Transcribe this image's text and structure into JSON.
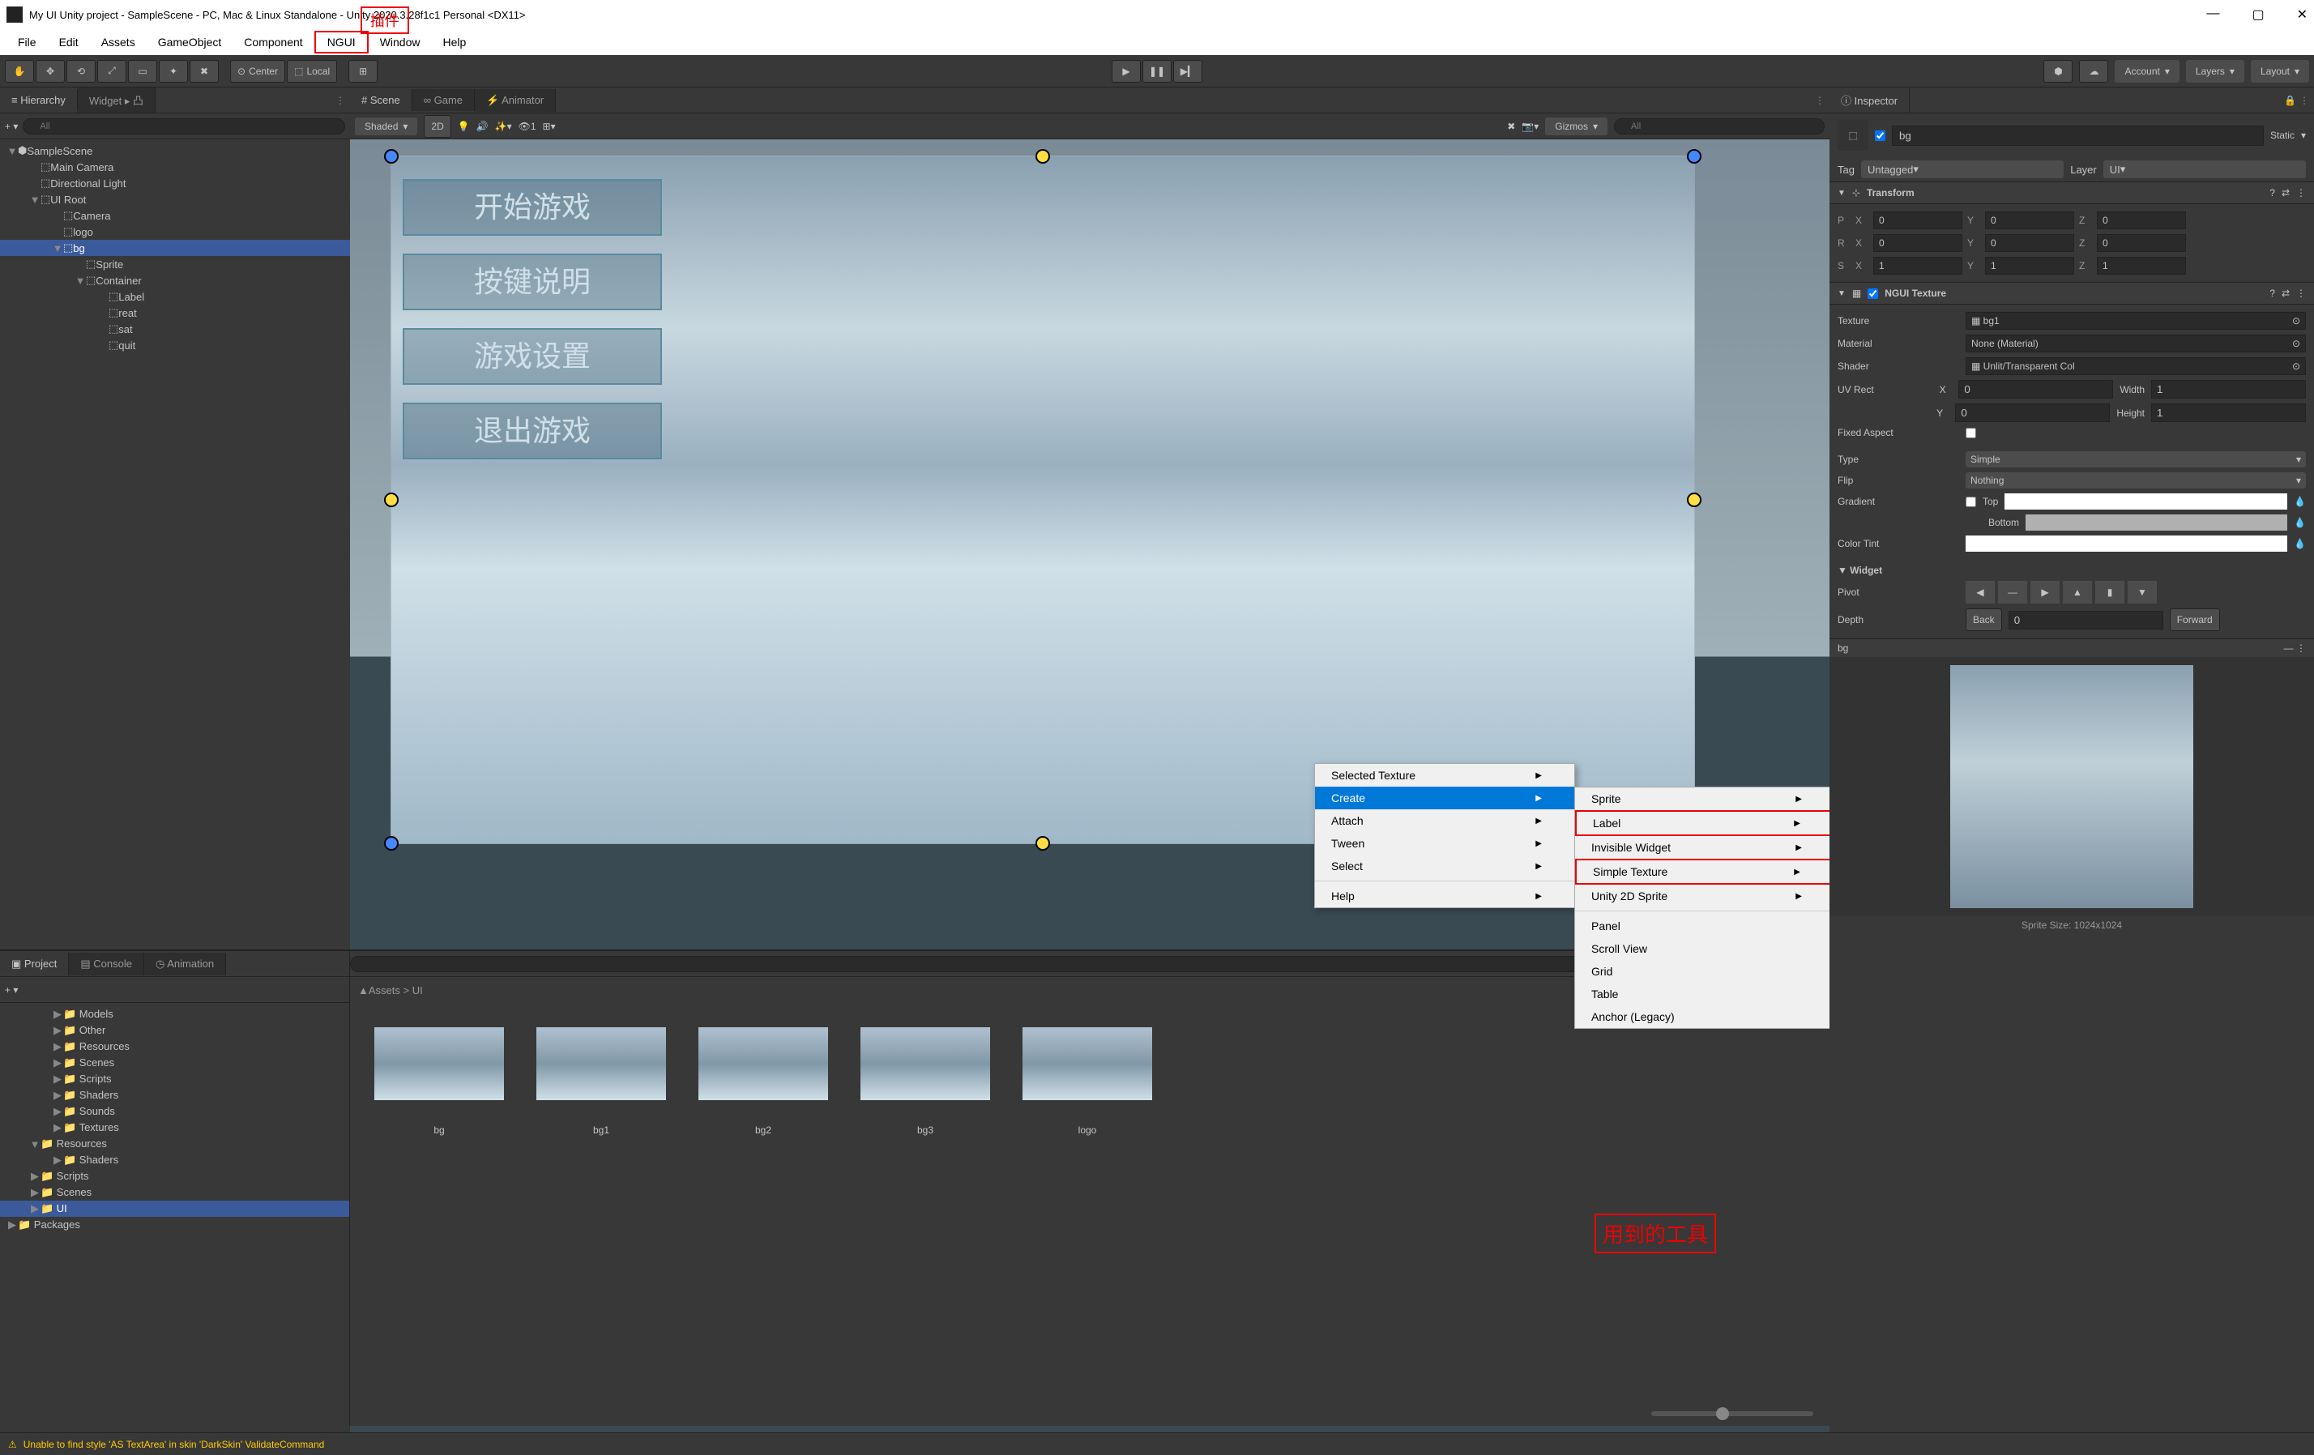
{
  "window": {
    "title": "My UI Unity project - SampleScene - PC, Mac & Linux Standalone - Unity 2020.3.28f1c1 Personal <DX11>"
  },
  "annotations": {
    "plugin_label": "插件",
    "tools_used": "用到的工具"
  },
  "menubar": [
    "File",
    "Edit",
    "Assets",
    "GameObject",
    "Component",
    "NGUI",
    "Window",
    "Help"
  ],
  "toolbar": {
    "pivot": "Center",
    "handle": "Local",
    "account": "Account",
    "layers": "Layers",
    "layout": "Layout"
  },
  "hierarchy": {
    "tab": "Hierarchy",
    "widget_tab": "Widget",
    "search_placeholder": "All",
    "items": [
      {
        "name": "SampleScene",
        "depth": 0,
        "icon": "scene",
        "expanded": true
      },
      {
        "name": "Main Camera",
        "depth": 1,
        "icon": "go"
      },
      {
        "name": "Directional Light",
        "depth": 1,
        "icon": "go"
      },
      {
        "name": "UI Root",
        "depth": 1,
        "icon": "go",
        "expanded": true
      },
      {
        "name": "Camera",
        "depth": 2,
        "icon": "go"
      },
      {
        "name": "logo",
        "depth": 2,
        "icon": "go"
      },
      {
        "name": "bg",
        "depth": 2,
        "icon": "go",
        "expanded": true,
        "selected": true
      },
      {
        "name": "Sprite",
        "depth": 3,
        "icon": "go"
      },
      {
        "name": "Container",
        "depth": 3,
        "icon": "go",
        "expanded": true
      },
      {
        "name": "Label",
        "depth": 4,
        "icon": "go"
      },
      {
        "name": "reat",
        "depth": 4,
        "icon": "go"
      },
      {
        "name": "sat",
        "depth": 4,
        "icon": "go"
      },
      {
        "name": "quit",
        "depth": 4,
        "icon": "go"
      }
    ]
  },
  "scene": {
    "tabs": [
      "Scene",
      "Game",
      "Animator"
    ],
    "shading": "Shaded",
    "twod": "2D",
    "gizmos": "Gizmos",
    "menu_buttons": [
      "开始游戏",
      "按键说明",
      "游戏设置",
      "退出游戏"
    ]
  },
  "context_menu": {
    "items": [
      {
        "label": "Selected Texture",
        "arrow": true
      },
      {
        "label": "Create",
        "arrow": true,
        "hover": true
      },
      {
        "label": "Attach",
        "arrow": true
      },
      {
        "label": "Tween",
        "arrow": true
      },
      {
        "label": "Select",
        "arrow": true
      },
      {
        "label": "Help",
        "arrow": true
      }
    ],
    "submenu": [
      {
        "label": "Sprite",
        "arrow": true
      },
      {
        "label": "Label",
        "arrow": true,
        "red": true
      },
      {
        "label": "Invisible Widget",
        "arrow": true
      },
      {
        "label": "Simple Texture",
        "arrow": true,
        "red": true
      },
      {
        "label": "Unity 2D Sprite",
        "arrow": true
      },
      {
        "label": "Panel"
      },
      {
        "label": "Scroll View"
      },
      {
        "label": "Grid"
      },
      {
        "label": "Table"
      },
      {
        "label": "Anchor (Legacy)"
      }
    ]
  },
  "project": {
    "tab": "Project",
    "console": "Console",
    "animation": "Animation",
    "folders": [
      {
        "name": "Models",
        "depth": 2
      },
      {
        "name": "Other",
        "depth": 2
      },
      {
        "name": "Resources",
        "depth": 2
      },
      {
        "name": "Scenes",
        "depth": 2
      },
      {
        "name": "Scripts",
        "depth": 2
      },
      {
        "name": "Shaders",
        "depth": 2
      },
      {
        "name": "Sounds",
        "depth": 2
      },
      {
        "name": "Textures",
        "depth": 2
      },
      {
        "name": "Resources",
        "depth": 1,
        "expanded": true
      },
      {
        "name": "Shaders",
        "depth": 2
      },
      {
        "name": "Scripts",
        "depth": 1
      },
      {
        "name": "Scenes",
        "depth": 1
      },
      {
        "name": "UI",
        "depth": 1,
        "selected": true
      },
      {
        "name": "Packages",
        "depth": 0
      }
    ],
    "breadcrumb": "Assets > UI",
    "assets": [
      "bg",
      "bg1",
      "bg2",
      "bg3",
      "logo"
    ]
  },
  "inspector": {
    "tab": "Inspector",
    "object_name": "bg",
    "static": "Static",
    "tag_label": "Tag",
    "tag": "Untagged",
    "layer_label": "Layer",
    "layer": "UI",
    "transform": {
      "title": "Transform",
      "position": {
        "label": "P",
        "x": "0",
        "y": "0",
        "z": "0"
      },
      "rotation": {
        "label": "R",
        "x": "0",
        "y": "0",
        "z": "0"
      },
      "scale": {
        "label": "S",
        "x": "1",
        "y": "1",
        "z": "1"
      }
    },
    "ngui_texture": {
      "title": "NGUI Texture",
      "texture_label": "Texture",
      "texture": "bg1",
      "material_label": "Material",
      "material": "None (Material)",
      "shader_label": "Shader",
      "shader": "Unlit/Transparent Col",
      "uvrect_label": "UV Rect",
      "uv_x": "0",
      "uv_y": "0",
      "width_label": "Width",
      "width": "1",
      "height_label": "Height",
      "height": "1",
      "fixed_aspect": "Fixed Aspect",
      "type_label": "Type",
      "type": "Simple",
      "flip_label": "Flip",
      "flip": "Nothing",
      "gradient_label": "Gradient",
      "gradient_top": "Top",
      "gradient_bottom": "Bottom",
      "color_tint": "Color Tint",
      "widget_label": "Widget",
      "pivot_label": "Pivot",
      "depth_label": "Depth",
      "depth_back": "Back",
      "depth_val": "0",
      "depth_fwd": "Forward"
    },
    "preview": {
      "title": "bg",
      "caption": "Sprite Size: 1024x1024"
    }
  },
  "status": {
    "message": "Unable to find style 'AS TextArea' in skin 'DarkSkin' ValidateCommand"
  }
}
